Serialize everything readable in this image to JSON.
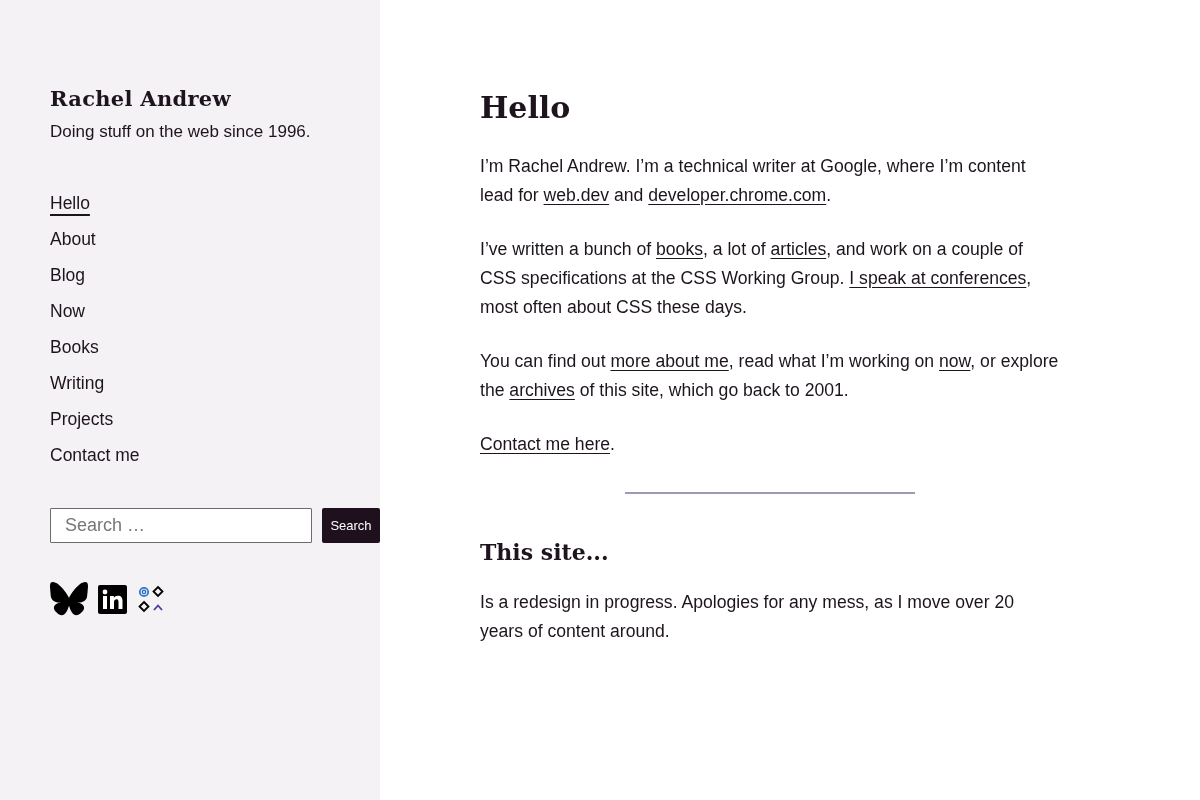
{
  "site": {
    "title": "Rachel Andrew",
    "tagline": "Doing stuff on the web since 1996."
  },
  "nav": [
    {
      "label": "Hello",
      "selected": true
    },
    {
      "label": "About",
      "selected": false
    },
    {
      "label": "Blog",
      "selected": false
    },
    {
      "label": "Now",
      "selected": false
    },
    {
      "label": "Books",
      "selected": false
    },
    {
      "label": "Writing",
      "selected": false
    },
    {
      "label": "Projects",
      "selected": false
    },
    {
      "label": "Contact me",
      "selected": false
    }
  ],
  "search": {
    "placeholder": "Search …",
    "button": "Search"
  },
  "social": [
    {
      "kind": "butterfly"
    },
    {
      "kind": "square-letters"
    },
    {
      "kind": "symbols"
    }
  ],
  "main": {
    "heading": "Hello",
    "paragraphs": [
      [
        {
          "kind": "text",
          "text": "I’m Rachel Andrew. I’m a technical writer at Google, where I’m content lead for "
        },
        {
          "kind": "link",
          "text": "web.dev"
        },
        {
          "kind": "text",
          "text": " and "
        },
        {
          "kind": "link",
          "text": "developer.chrome.com"
        },
        {
          "kind": "text",
          "text": "."
        }
      ],
      [
        {
          "kind": "text",
          "text": "I’ve written a bunch of "
        },
        {
          "kind": "link",
          "text": "books"
        },
        {
          "kind": "text",
          "text": ", a lot of "
        },
        {
          "kind": "link",
          "text": "articles"
        },
        {
          "kind": "text",
          "text": ", and work on a couple of CSS specifications at the CSS Working Group. "
        },
        {
          "kind": "link",
          "text": "I speak at conferences"
        },
        {
          "kind": "text",
          "text": ", most often about CSS these days."
        }
      ],
      [
        {
          "kind": "text",
          "text": "You can find out "
        },
        {
          "kind": "link",
          "text": "more about me"
        },
        {
          "kind": "text",
          "text": ", read what I’m working on "
        },
        {
          "kind": "link",
          "text": "now"
        },
        {
          "kind": "text",
          "text": ", or explore the "
        },
        {
          "kind": "link",
          "text": "archives"
        },
        {
          "kind": "text",
          "text": " of this site, which go back to 2001."
        }
      ],
      [
        {
          "kind": "link",
          "text": "Contact me here"
        },
        {
          "kind": "text",
          "text": "."
        }
      ]
    ],
    "section": {
      "heading": "This site...",
      "paragraphs": [
        [
          {
            "kind": "text",
            "text": "Is a redesign in progress. Apologies for any mess, as I move over 20 years of content around."
          }
        ]
      ]
    }
  }
}
